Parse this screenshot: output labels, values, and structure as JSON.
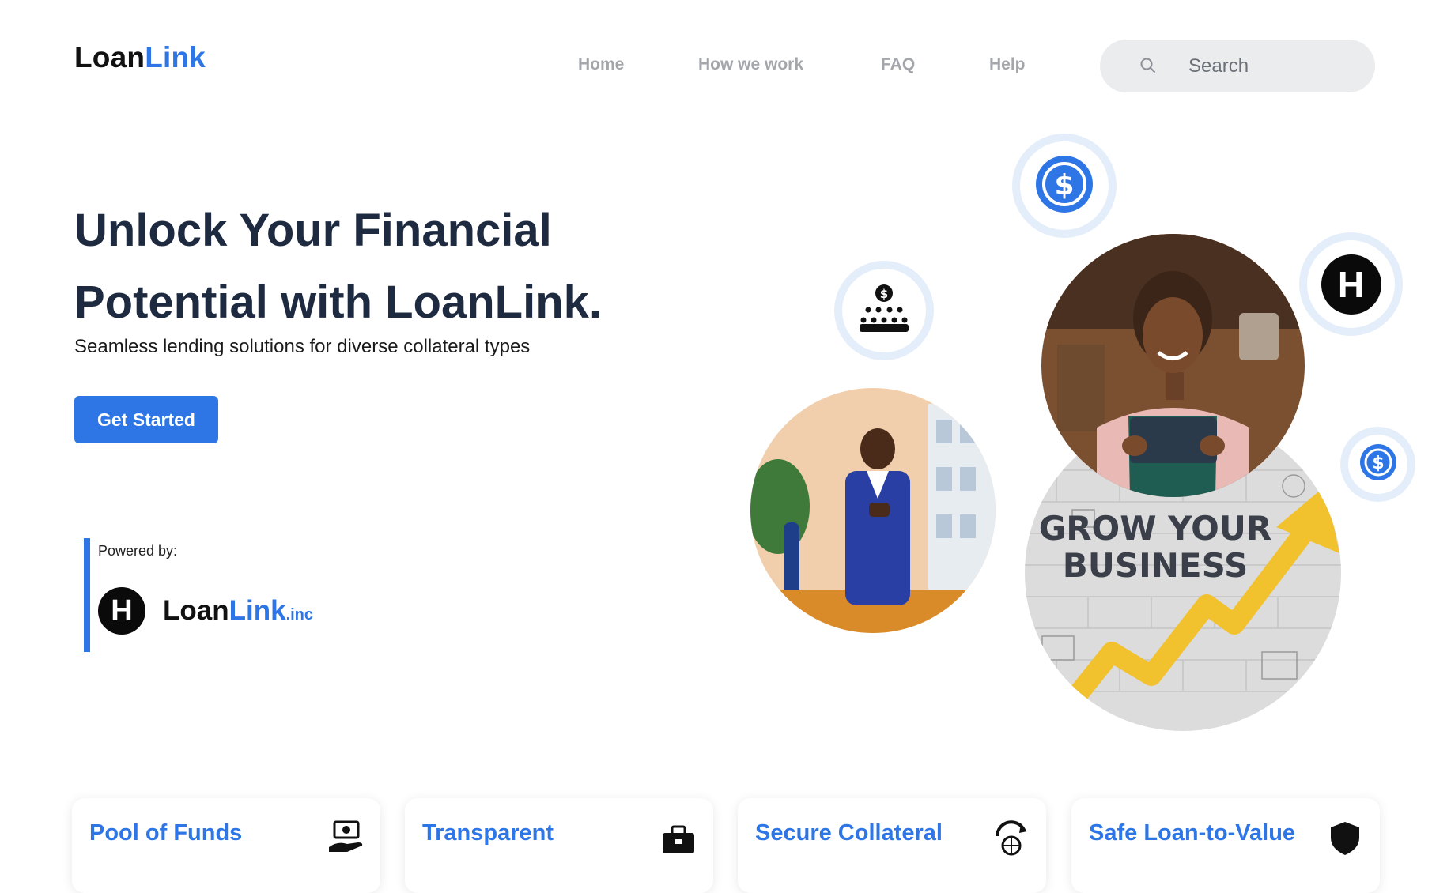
{
  "header": {
    "logo": {
      "part1": "Loan",
      "part2": "Link"
    },
    "nav": [
      {
        "label": "Home"
      },
      {
        "label": "How we work"
      },
      {
        "label": "FAQ"
      },
      {
        "label": "Help"
      }
    ],
    "search": {
      "placeholder": "Search",
      "icon": "search-icon"
    }
  },
  "hero": {
    "headline": "Unlock Your Financial Potential with LoanLink.",
    "subtitle": "Seamless lending solutions for diverse collateral types",
    "cta_label": "Get Started",
    "powered_by": {
      "label": "Powered by:",
      "badge_letter": "H",
      "brand_part1": "Loan",
      "brand_part2": "Link",
      "brand_suffix": ".inc"
    },
    "art": {
      "bubbles": [
        {
          "icon": "dollar-coin-icon"
        },
        {
          "icon": "crowdfunding-icon"
        },
        {
          "icon": "hedera-icon",
          "letter": "H"
        },
        {
          "icon": "dollar-coin-icon"
        }
      ],
      "photos": [
        {
          "subject": "businessman-on-phone"
        },
        {
          "subject": "smiling-woman-with-tablet"
        },
        {
          "subject": "grow-your-business-wall",
          "text": "GROW YOUR BUSINESS"
        }
      ]
    }
  },
  "features": [
    {
      "title": "Pool of Funds",
      "icon": "money-hand-icon"
    },
    {
      "title": "Transparent",
      "icon": "briefcase-icon"
    },
    {
      "title": "Secure Collateral",
      "icon": "globe-cycle-icon"
    },
    {
      "title": "Safe Loan-to-Value",
      "icon": "shield-icon"
    }
  ],
  "colors": {
    "accent": "#2e76e5",
    "heading": "#1e2a40",
    "nav_text": "#a3a6ab",
    "search_bg": "#ebecee"
  }
}
